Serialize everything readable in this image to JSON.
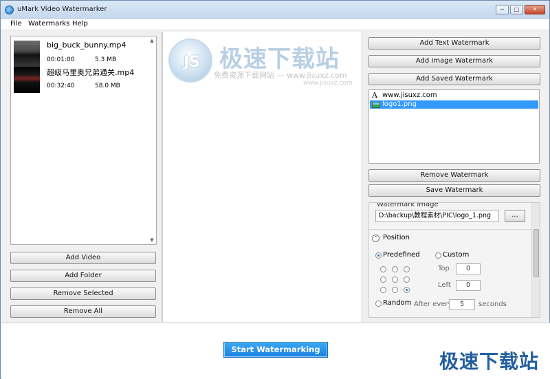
{
  "window": {
    "title": "uMark Video Watermarker",
    "minimize": "─",
    "maximize": "□",
    "close": "✕"
  },
  "menu": {
    "items": [
      "File",
      "Watermarks",
      "Help"
    ]
  },
  "videos": [
    {
      "name": "big_buck_bunny.mp4",
      "duration": "00:01:00",
      "size": "5.3 MB"
    },
    {
      "name": "超级马里奥兄弟通关.mp4",
      "duration": "00:32:40",
      "size": "58.0 MB"
    }
  ],
  "left_buttons": {
    "add_video": "Add Video",
    "add_folder": "Add Folder",
    "remove_selected": "Remove Selected",
    "remove_all": "Remove All"
  },
  "preview_watermark": {
    "logo_text": "JS",
    "title": "极速下载站",
    "subtitle": "免费资源下载网站 — www.jisuxz.com",
    "url": "www.jisuxz.com"
  },
  "right_buttons": {
    "add_text": "Add Text Watermark",
    "add_image": "Add Image Watermark",
    "add_saved": "Add Saved Watermark",
    "remove": "Remove Watermark",
    "save": "Save Watermark"
  },
  "watermark_list": [
    {
      "type": "text",
      "glyph": "A",
      "label": "www.jisuxz.com",
      "selected": false
    },
    {
      "type": "image",
      "label": "logo1.png",
      "selected": true
    }
  ],
  "settings": {
    "image_legend": "Watermark Image",
    "image_path": "D:\\backup\\教程素材\\PIC\\logo_1.png",
    "browse_label": "...",
    "position_title": "Position",
    "expander": "⌃",
    "predefined_label": "Predefined",
    "custom_label": "Custom",
    "top_label": "Top",
    "top_value": "0",
    "left_label": "Left",
    "left_value": "0",
    "random_label": "Random",
    "after_every_label": "After every",
    "seconds_value": "5",
    "seconds_label": "seconds",
    "selected_grid_index": 8
  },
  "start_button": "Start Watermarking",
  "brand_watermark": "极速下载站"
}
